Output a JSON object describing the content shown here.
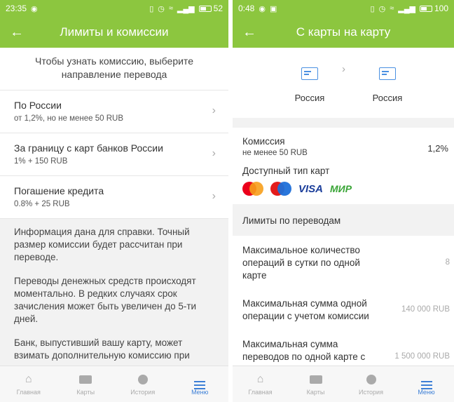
{
  "left": {
    "status": {
      "time": "23:35",
      "battery": "52"
    },
    "title": "Лимиты и комиссии",
    "hint": "Чтобы узнать комиссию, выберите направление перевода",
    "directions": [
      {
        "title": "По России",
        "subtitle": "от 1,2%, но не менее 50 RUB"
      },
      {
        "title": "За границу с карт банков России",
        "subtitle": "1% + 150 RUB"
      },
      {
        "title": "Погашение кредита",
        "subtitle": "0.8% + 25 RUB"
      }
    ],
    "info": [
      "Информация дана для справки. Точный размер комиссии будет рассчитан при переводе.",
      "Переводы денежных средств происходят моментально. В редких случаях срок зачисления может быть увеличен до 5-ти дней.",
      "Банк, выпустивший вашу карту, может взимать дополнительную комиссию при переводе."
    ]
  },
  "right": {
    "status": {
      "time": "0:48",
      "battery": "100"
    },
    "title": "С карты на карту",
    "from_label": "Россия",
    "to_label": "Россия",
    "commission": {
      "title": "Комиссия",
      "subtitle": "не менее 50 RUB",
      "value": "1,2%"
    },
    "card_types": {
      "title": "Доступный тип карт",
      "visa": "VISA",
      "mir": "МИР"
    },
    "limits_header": "Лимиты по переводам",
    "limits": [
      {
        "label": "Максимальное количество операций в сутки по одной карте",
        "value": "8"
      },
      {
        "label": "Максимальная сумма одной операции с учетом комиссии",
        "value": "140 000 RUB"
      },
      {
        "label": "Максимальная сумма переводов по одной карте с учетом комиссии в месяц",
        "value": "1 500 000 RUB"
      }
    ]
  },
  "nav": {
    "home": "Главная",
    "cards": "Карты",
    "history": "История",
    "menu": "Меню"
  },
  "colors": {
    "primary": "#8cc63f",
    "accent": "#3d7fd6"
  }
}
